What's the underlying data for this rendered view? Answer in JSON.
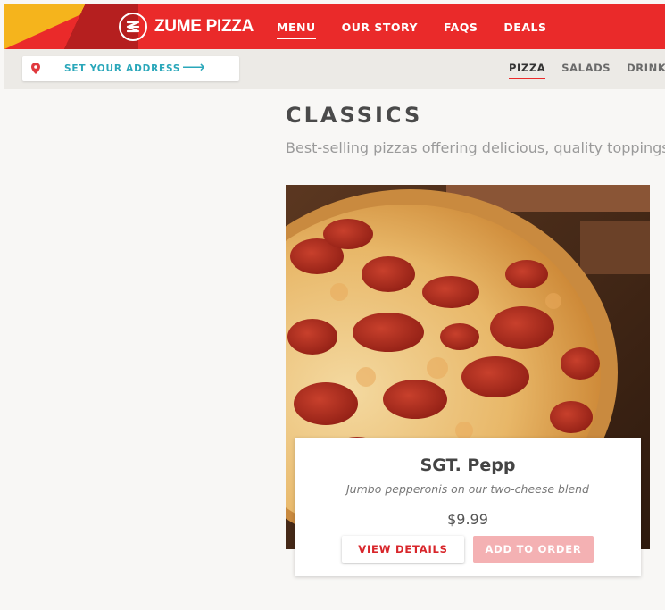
{
  "brand": {
    "name": "ZUME PIZZA",
    "logo_icon": "zume-logo-icon"
  },
  "nav": {
    "items": [
      {
        "label": "MENU",
        "active": true
      },
      {
        "label": "OUR STORY",
        "active": false
      },
      {
        "label": "FAQS",
        "active": false
      },
      {
        "label": "DEALS",
        "active": false
      }
    ]
  },
  "address": {
    "label": "SET YOUR ADDRESS",
    "arrow": "⟶",
    "icon": "location-pin-icon"
  },
  "categories": [
    {
      "label": "PIZZA",
      "active": true
    },
    {
      "label": "SALADS",
      "active": false
    },
    {
      "label": "DRINKS",
      "active": false
    }
  ],
  "section": {
    "title": "CLASSICS",
    "subtitle": "Best-selling pizzas offering delicious, quality toppings"
  },
  "product": {
    "name": "SGT. Pepp",
    "description": "Jumbo pepperonis on our two-cheese blend",
    "price": "$9.99",
    "view_label": "VIEW DETAILS",
    "add_label": "ADD TO ORDER"
  },
  "colors": {
    "brand_red": "#ea2a2a",
    "brand_yellow": "#f5b41c",
    "teal": "#2aa7ba",
    "add_disabled": "#f4b1b3"
  }
}
